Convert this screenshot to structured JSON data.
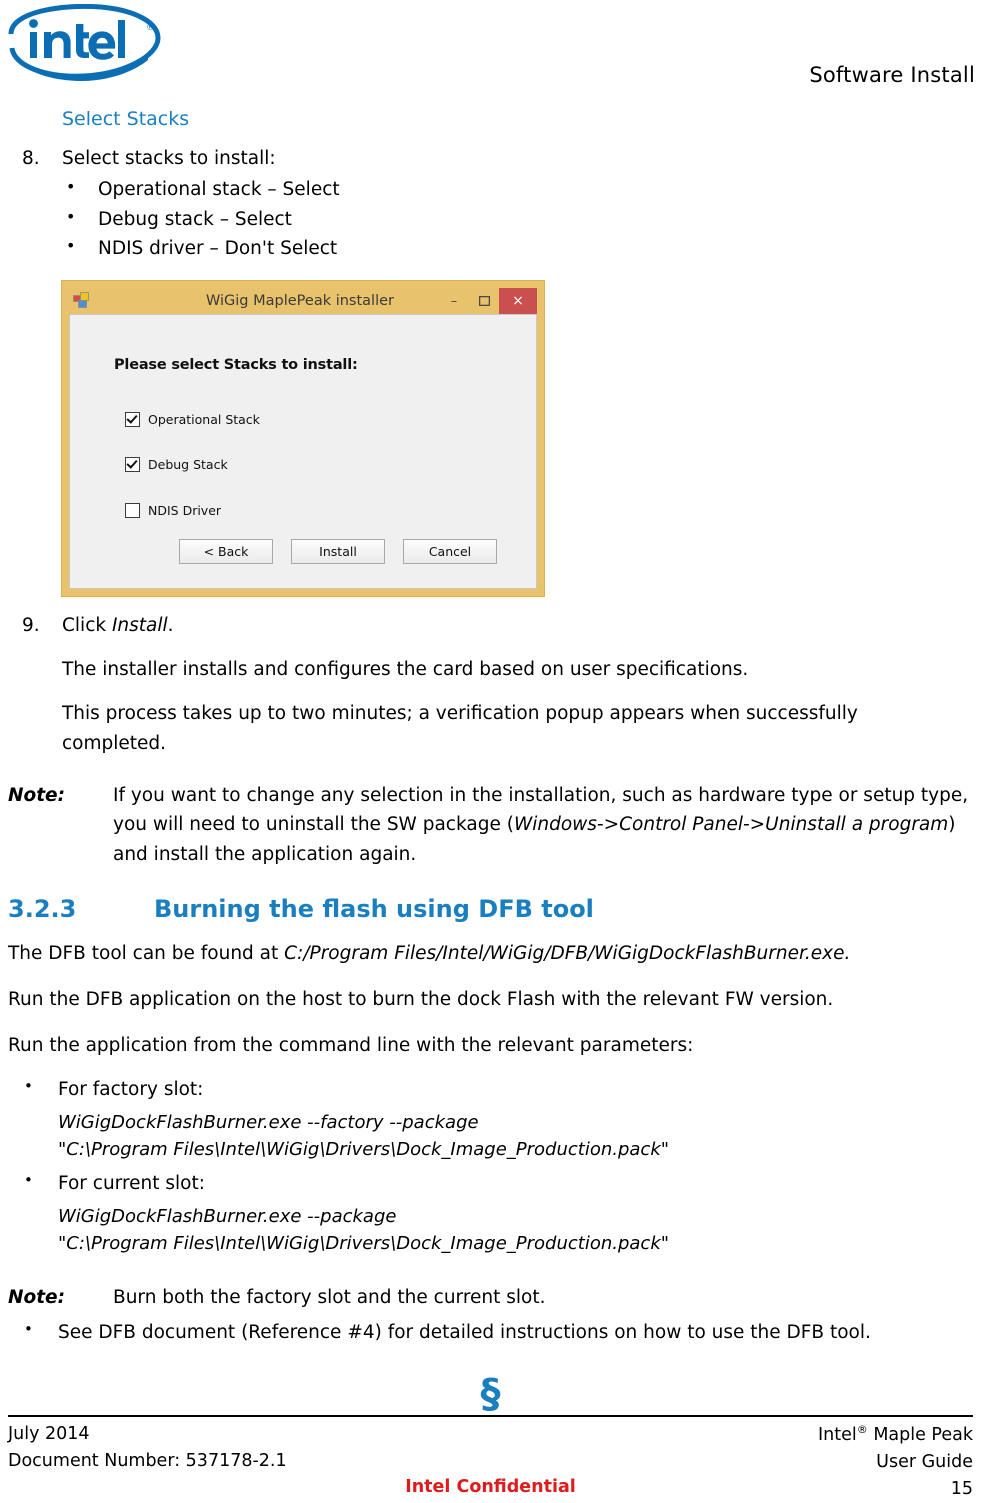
{
  "header": {
    "logo_alt": "intel",
    "logo_registered": "®",
    "title": "Software Install"
  },
  "body": {
    "subheading": "Select Stacks",
    "step8": {
      "number": "8.",
      "text": "Select stacks to install:",
      "bullets": [
        "Operational stack – Select",
        "Debug stack – Select",
        "NDIS driver – Don't Select"
      ]
    },
    "step9": {
      "number": "9.",
      "prefix": "Click ",
      "emphasis": "Install",
      "suffix": ".",
      "paragraphs": [
        "The installer installs and configures the card based on user specifications.",
        "This process takes up to two minutes; a verification popup appears when successfully completed."
      ]
    },
    "note1": {
      "label": "Note:",
      "part1": "If you want to change any selection in the installation, such as hardware type or setup type, you will need to uninstall the SW package (",
      "emphasis": "Windows->Control Panel->Uninstall a program",
      "part2": ") and install the application again."
    },
    "section": {
      "number": "3.2.3",
      "title": "Burning the flash using DFB tool"
    },
    "dfb_intro": {
      "prefix": "The DFB tool can be found at ",
      "path": "C:/Program Files/Intel/WiGig/DFB/WiGigDockFlashBurner.exe.",
      "line2": "Run the DFB application on the host to burn the dock Flash with the relevant FW version.",
      "line3": "Run the application from the command line with the relevant parameters:"
    },
    "slots": [
      {
        "label": "For factory slot:",
        "command": "WiGigDockFlashBurner.exe --factory --package\n\"C:\\Program Files\\Intel\\WiGig\\Drivers\\Dock_Image_Production.pack\""
      },
      {
        "label": "For current slot:",
        "command": "WiGigDockFlashBurner.exe --package\n\"C:\\Program Files\\Intel\\WiGig\\Drivers\\Dock_Image_Production.pack\""
      }
    ],
    "note2": {
      "label": "Note:",
      "text": "Burn both the factory slot and the current slot."
    },
    "final_bullet": "See DFB document (Reference #4) for detailed instructions on how to use the DFB tool.",
    "section_mark": "§"
  },
  "installer_dialog": {
    "window_title": "WiGig MaplePeak installer",
    "app_icon": "installer-app-icon",
    "controls": {
      "minimize": "–",
      "maximize": "❑",
      "close": "×"
    },
    "heading": "Please select Stacks to install:",
    "checkboxes": [
      {
        "label": "Operational Stack",
        "checked": true
      },
      {
        "label": "Debug Stack",
        "checked": true
      },
      {
        "label": "NDIS Driver",
        "checked": false
      }
    ],
    "buttons": [
      {
        "label": "< Back"
      },
      {
        "label": "Install"
      },
      {
        "label": "Cancel"
      }
    ],
    "colors": {
      "titlebar": "#e9c26c",
      "close_button": "#c9504f",
      "body": "#f0f0f0"
    }
  },
  "footer": {
    "date": "July 2014",
    "doc_number": "Document Number: 537178-2.1",
    "product": "Intel",
    "product_registered": "®",
    "product_rest": " Maple Peak",
    "guide": "User Guide",
    "page_number": "15",
    "confidential": "Intel Confidential",
    "confidential_color": "#e01b1b"
  }
}
